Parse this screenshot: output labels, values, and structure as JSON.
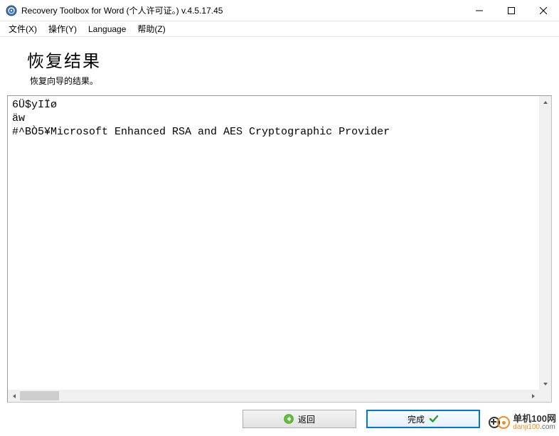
{
  "window": {
    "title": "Recovery Toolbox for Word (个人许可证。) v.4.5.17.45"
  },
  "menu": {
    "file": "文件(X)",
    "action": "操作(Y)",
    "language": "Language",
    "help": "帮助(Z)"
  },
  "header": {
    "title": "恢复结果",
    "subtitle": "恢复向导的结果。"
  },
  "content": {
    "text": "6Ü$yIÏø\näw\n#^BÒ5¥Microsoft Enhanced RSA and AES Cryptographic Provider"
  },
  "footer": {
    "back_label": "返回",
    "finish_label": "完成"
  },
  "watermark": {
    "name_cn": "单机100网",
    "domain_prefix": "danji100",
    "domain_suffix": ".com"
  }
}
